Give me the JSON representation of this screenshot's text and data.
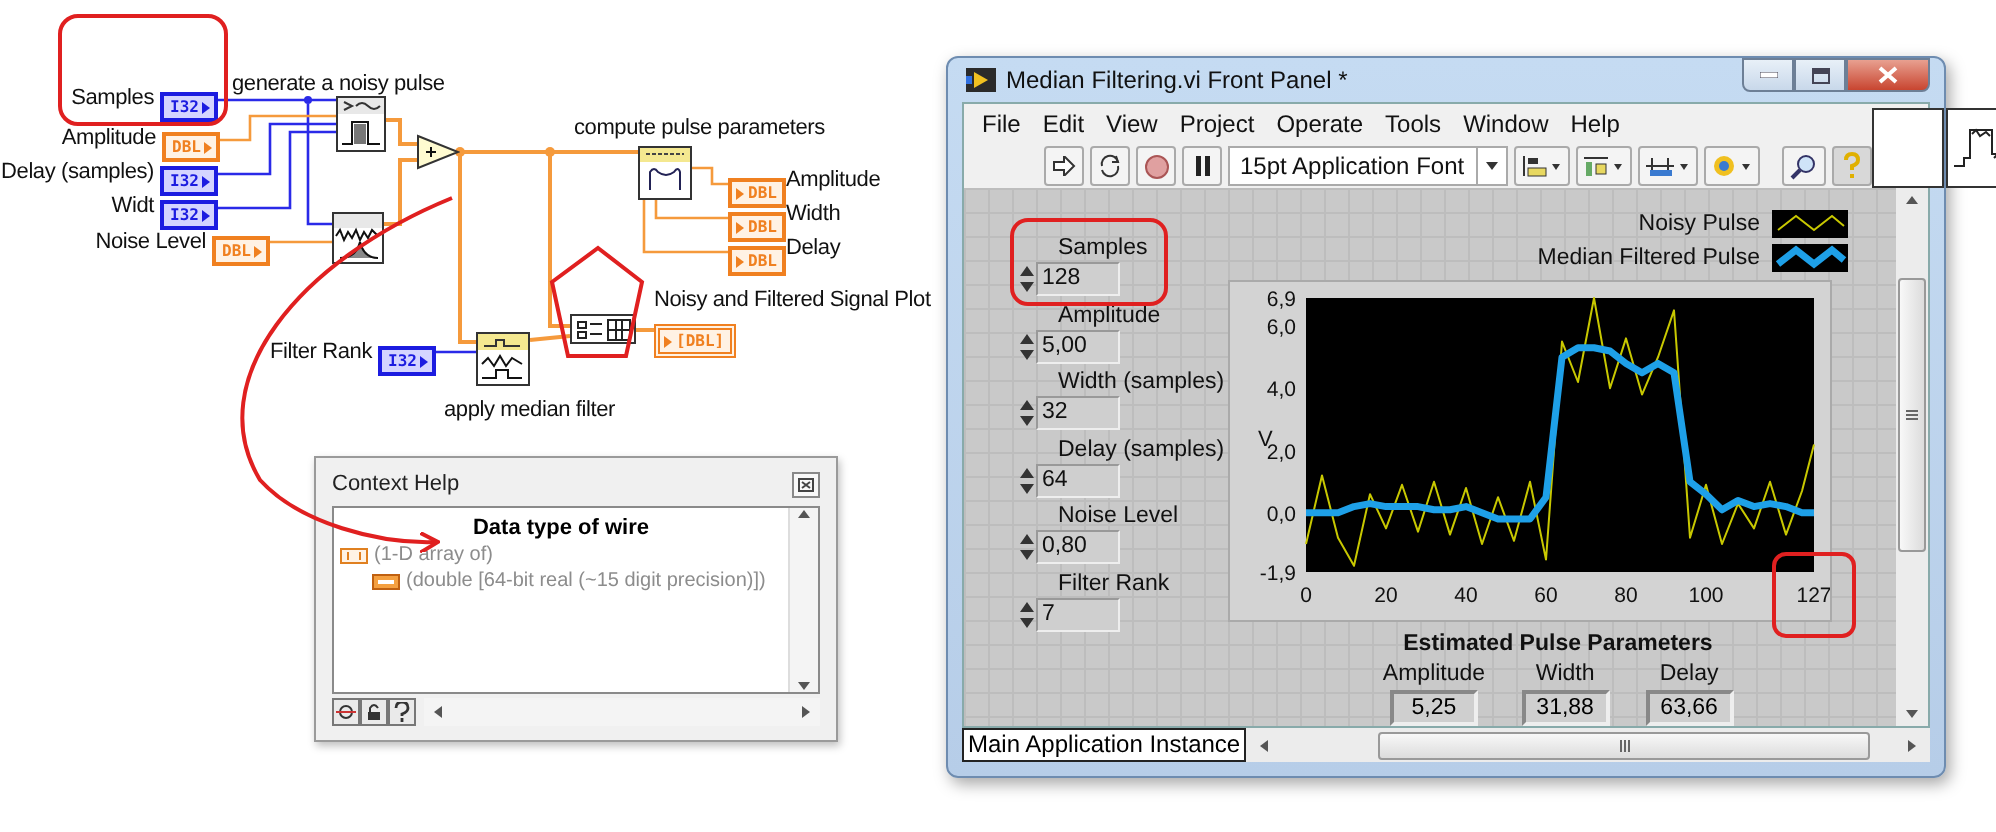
{
  "block_diagram": {
    "inputs": [
      {
        "label": "Samples",
        "terminal": "I32",
        "kind": "integer"
      },
      {
        "label": "Amplitude",
        "terminal": "DBL",
        "kind": "double"
      },
      {
        "label": "Delay (samples)",
        "terminal": "I32",
        "kind": "integer"
      },
      {
        "label": "Widt",
        "terminal": "I32",
        "kind": "integer"
      },
      {
        "label": "Noise Level",
        "terminal": "DBL",
        "kind": "double"
      },
      {
        "label": "Filter Rank",
        "terminal": "I32",
        "kind": "integer"
      }
    ],
    "node_labels": [
      "generate a noisy pulse",
      "compute pulse parameters",
      "apply median filter"
    ],
    "outputs": [
      {
        "label": "Amplitude",
        "terminal": "DBL",
        "kind": "double"
      },
      {
        "label": "Width",
        "terminal": "DBL",
        "kind": "double"
      },
      {
        "label": "Delay",
        "terminal": "DBL",
        "kind": "double"
      },
      {
        "label": "Noisy and Filtered Signal Plot",
        "terminal": "[DBL]",
        "kind": "array"
      }
    ]
  },
  "context_help": {
    "title": "Context Help",
    "heading": "Data type of wire",
    "lines": [
      "(1-D array of)",
      "(double [64-bit real (~15 digit precision)])"
    ]
  },
  "front_panel": {
    "title": "Median Filtering.vi Front Panel *",
    "menu": [
      "File",
      "Edit",
      "View",
      "Project",
      "Operate",
      "Tools",
      "Window",
      "Help"
    ],
    "font": "15pt Application Font",
    "controls": [
      {
        "label": "Samples",
        "value": "128"
      },
      {
        "label": "Amplitude",
        "value": "5,00"
      },
      {
        "label": "Width (samples)",
        "value": "32"
      },
      {
        "label": "Delay (samples)",
        "value": "64"
      },
      {
        "label": "Noise Level",
        "value": "0,80"
      },
      {
        "label": "Filter Rank",
        "value": "7"
      }
    ],
    "chart_data": {
      "type": "line",
      "ylabel": "V",
      "x": [
        0,
        4,
        8,
        12,
        16,
        20,
        24,
        28,
        32,
        36,
        40,
        44,
        48,
        52,
        56,
        60,
        64,
        68,
        72,
        76,
        80,
        84,
        88,
        92,
        96,
        100,
        104,
        108,
        112,
        116,
        120,
        124,
        127
      ],
      "xlim": [
        0,
        127
      ],
      "ylim": [
        -1.9,
        6.9
      ],
      "xticks": [
        0,
        20,
        40,
        60,
        80,
        100,
        127
      ],
      "yticks": [
        {
          "value": -1.9,
          "label": "-1,9"
        },
        {
          "value": 0,
          "label": "0,0"
        },
        {
          "value": 2,
          "label": "2,0"
        },
        {
          "value": 4,
          "label": "4,0"
        },
        {
          "value": 6,
          "label": "6,0"
        },
        {
          "value": 6.9,
          "label": "6,9"
        }
      ],
      "series": [
        {
          "name": "Noisy Pulse",
          "color": "#c8c800",
          "values": [
            -1.0,
            1.2,
            -0.8,
            -1.7,
            0.6,
            -0.5,
            0.9,
            -0.6,
            1.0,
            -0.7,
            0.8,
            -1.0,
            0.5,
            -0.9,
            1.0,
            -1.5,
            5.5,
            4.2,
            6.9,
            4.0,
            5.6,
            3.8,
            5.0,
            6.5,
            -0.8,
            0.9,
            -1.0,
            0.3,
            -0.5,
            1.0,
            -0.7,
            0.7,
            2.2
          ]
        },
        {
          "name": "Median Filtered Pulse",
          "color": "#1ea0e8",
          "values": [
            0,
            0,
            0,
            0.2,
            0.3,
            0.2,
            0.2,
            0.2,
            0.1,
            0.1,
            0.2,
            0,
            -0.2,
            -0.2,
            -0.2,
            0.5,
            5.0,
            5.3,
            5.3,
            5.2,
            4.8,
            4.5,
            4.8,
            4.5,
            1.0,
            0.6,
            0.1,
            0.4,
            0.2,
            0.3,
            0.2,
            0,
            0
          ]
        }
      ]
    },
    "results": {
      "title": "Estimated Pulse Parameters",
      "items": [
        {
          "label": "Amplitude",
          "value": "5,25"
        },
        {
          "label": "Width",
          "value": "31,88"
        },
        {
          "label": "Delay",
          "value": "63,66"
        }
      ]
    },
    "instance": "Main Application Instance"
  }
}
